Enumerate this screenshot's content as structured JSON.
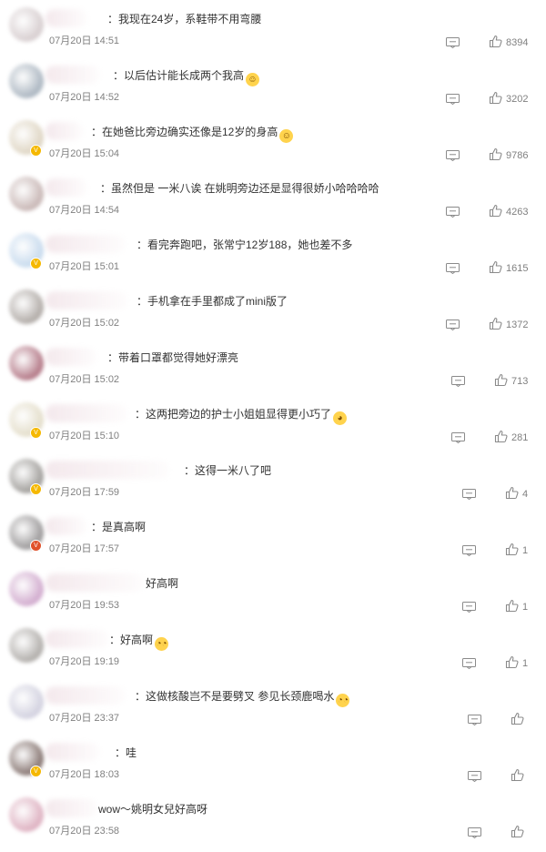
{
  "comments": [
    {
      "prefix": "",
      "text": "：我现在24岁，系鞋带不用弯腰",
      "time": "07月20日 14:51",
      "likes": "8394",
      "badge": "",
      "emoji": "",
      "avatar_color": "#cfc4c6"
    },
    {
      "prefix": "",
      "text": "：以后估计能长成两个我高",
      "time": "07月20日 14:52",
      "likes": "3202",
      "badge": "",
      "emoji": "laugh-cry-emoji",
      "avatar_color": "#9aa7b4"
    },
    {
      "prefix": "",
      "text": "：在她爸比旁边确实还像是12岁的身高",
      "time": "07月20日 15:04",
      "likes": "9786",
      "badge": "gold",
      "emoji": "laugh-cry-emoji",
      "avatar_color": "#d8cdb7"
    },
    {
      "prefix": "",
      "text": "：虽然但是 一米八诶 在姚明旁边还是显得很娇小哈哈哈哈",
      "time": "07月20日 14:54",
      "likes": "4263",
      "badge": "",
      "emoji": "",
      "avatar_color": "#bda8a6"
    },
    {
      "prefix": "",
      "text": "：看完奔跑吧，张常宁12岁188，她也差不多",
      "time": "07月20日 15:01",
      "likes": "1615",
      "badge": "gold",
      "emoji": "",
      "avatar_color": "#bcd3ea"
    },
    {
      "prefix": "",
      "text": "：手机拿在手里都成了mini版了",
      "time": "07月20日 15:02",
      "likes": "1372",
      "badge": "",
      "emoji": "",
      "avatar_color": "#a19a95"
    },
    {
      "prefix": "",
      "text": "：带着口罩都觉得她好漂亮",
      "time": "07月20日 15:02",
      "likes": "713",
      "badge": "",
      "emoji": "",
      "avatar_color": "#a45d6e"
    },
    {
      "prefix": "",
      "text": "：这两把旁边的护士小姐姐显得更小巧了",
      "time": "07月20日 15:10",
      "likes": "281",
      "badge": "gold",
      "emoji": "doge-emoji",
      "avatar_color": "#ded7bf"
    },
    {
      "prefix": "",
      "text": "：这得一米八了吧",
      "time": "07月20日 17:59",
      "likes": "4",
      "badge": "gold",
      "emoji": "",
      "avatar_color": "#8d8a86"
    },
    {
      "prefix": "",
      "text": "：是真高啊",
      "time": "07月20日 17:57",
      "likes": "1",
      "badge": "red",
      "emoji": "",
      "avatar_color": "#878485"
    },
    {
      "prefix": "",
      "text": "好高啊",
      "time": "07月20日 19:53",
      "likes": "1",
      "badge": "",
      "emoji": "",
      "avatar_color": "#c89ac4"
    },
    {
      "prefix": "",
      "text": "：好高啊",
      "time": "07月20日 19:19",
      "likes": "1",
      "badge": "",
      "emoji": "glasses-emoji",
      "avatar_color": "#a19d99"
    },
    {
      "prefix": "",
      "text": "：这做核酸岂不是要劈叉 参见长颈鹿喝水",
      "time": "07月20日 23:37",
      "likes": "",
      "badge": "",
      "emoji": "glasses-emoji",
      "avatar_color": "#c9c8d9"
    },
    {
      "prefix": "",
      "text": "：哇",
      "time": "07月20日 18:03",
      "likes": "",
      "badge": "gold",
      "emoji": "",
      "avatar_color": "#6f5a55"
    },
    {
      "prefix": "",
      "text": "wow～姚明女兒好高呀",
      "time": "07月20日 23:58",
      "likes": "",
      "badge": "",
      "emoji": "",
      "avatar_color": "#d7a1b4"
    }
  ],
  "colors": {
    "text": "#333333",
    "muted": "#808080",
    "badge_gold": "#f5b800",
    "badge_red": "#e0512a"
  }
}
